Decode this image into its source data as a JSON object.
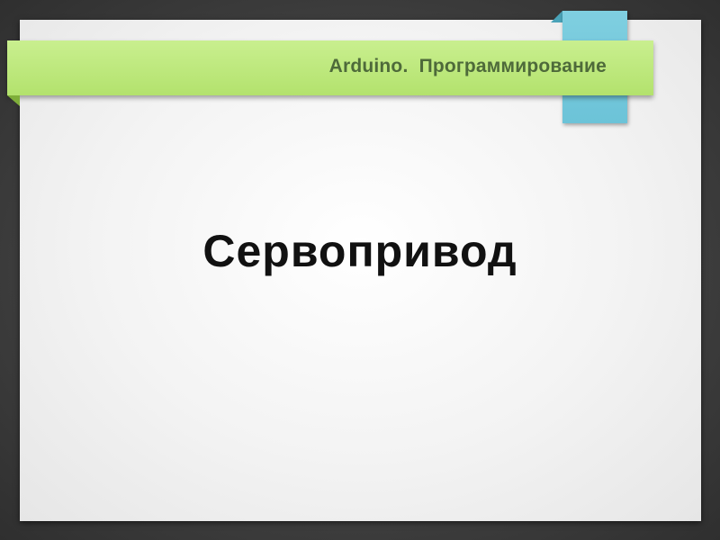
{
  "banner": {
    "title": "Arduino.  Программирование"
  },
  "slide": {
    "title": "Сервопривод"
  },
  "colors": {
    "background": "#3f3f3f",
    "slide": "#f3f3f3",
    "banner_green": "#b8e676",
    "banner_text": "#4e6a3a",
    "tab_blue": "#7fcfe0",
    "title_text": "#111111"
  }
}
